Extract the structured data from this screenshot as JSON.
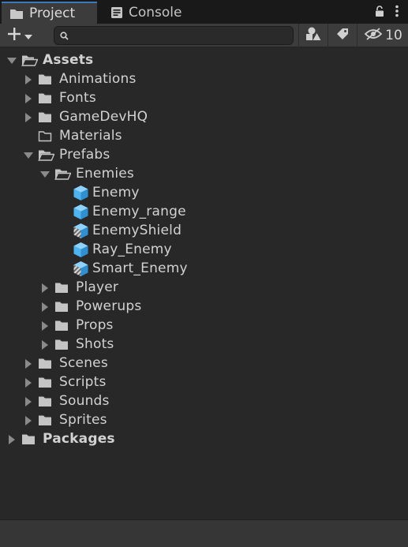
{
  "tabs": [
    {
      "label": "Project",
      "icon": "folder-icon",
      "active": true
    },
    {
      "label": "Console",
      "icon": "console-icon",
      "active": false
    }
  ],
  "toolbar": {
    "search_placeholder": "",
    "hidden_count": "10"
  },
  "tree": {
    "assets": {
      "label": "Assets"
    },
    "animations": {
      "label": "Animations"
    },
    "fonts": {
      "label": "Fonts"
    },
    "gamedevhq": {
      "label": "GameDevHQ"
    },
    "materials": {
      "label": "Materials"
    },
    "prefabs": {
      "label": "Prefabs"
    },
    "enemies": {
      "label": "Enemies"
    },
    "enemy": {
      "label": "Enemy"
    },
    "enemy_range": {
      "label": "Enemy_range"
    },
    "enemy_shield": {
      "label": "EnemyShield"
    },
    "ray_enemy": {
      "label": "Ray_Enemy"
    },
    "smart_enemy": {
      "label": "Smart_Enemy"
    },
    "player": {
      "label": "Player"
    },
    "powerups": {
      "label": "Powerups"
    },
    "props": {
      "label": "Props"
    },
    "shots": {
      "label": "Shots"
    },
    "scenes": {
      "label": "Scenes"
    },
    "scripts": {
      "label": "Scripts"
    },
    "sounds": {
      "label": "Sounds"
    },
    "sprites": {
      "label": "Sprites"
    },
    "packages": {
      "label": "Packages"
    }
  },
  "colors": {
    "accent": "#3a79bb",
    "prefab_blue": "#4fb3ef",
    "background": "#282828"
  }
}
